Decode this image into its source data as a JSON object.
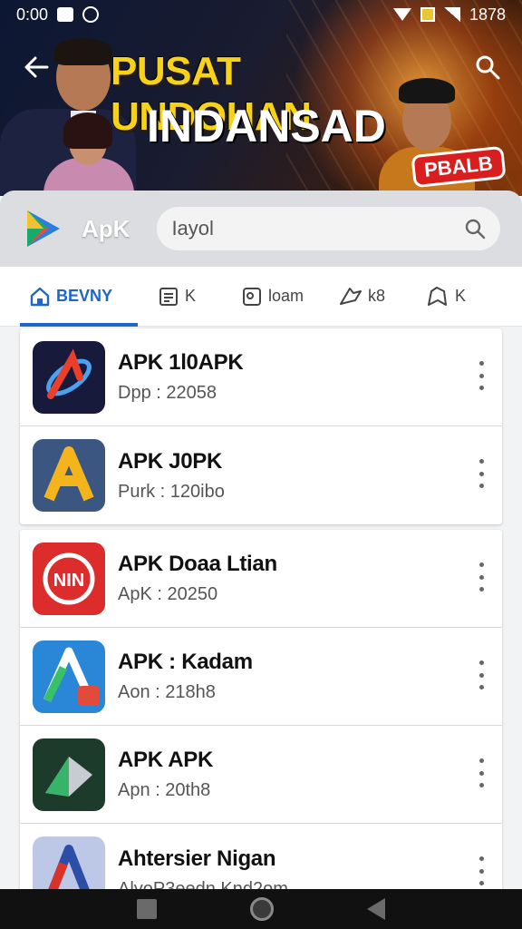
{
  "status_bar": {
    "time": "0:00",
    "battery": "1878"
  },
  "banner": {
    "title": "PUSAT UNDOHAN",
    "subtitle": "INDANSAD",
    "badge": "PBALB"
  },
  "header": {
    "app_name": "ApK",
    "search": {
      "value": "Iayol",
      "placeholder": ""
    }
  },
  "tabs": [
    {
      "label": "BEVNY",
      "icon": "home-icon",
      "active": true
    },
    {
      "label": "K",
      "icon": "document-icon",
      "active": false
    },
    {
      "label": "loam",
      "icon": "image-icon",
      "active": false
    },
    {
      "label": "k8",
      "icon": "tag-icon",
      "active": false
    },
    {
      "label": "K",
      "icon": "bookmark-icon",
      "active": false
    }
  ],
  "apps": [
    {
      "title": "APK 1l0APK",
      "subtitle": "Dpp : 22058",
      "icon_color": "#171a3a"
    },
    {
      "title": "APK J0PK",
      "subtitle": "Purk : 120ibo",
      "icon_color": "#3b5680"
    },
    {
      "title": "APK Doaa Ltian",
      "subtitle": "ApK : 20250",
      "icon_color": "#dd2c2c"
    },
    {
      "title": "APK : Kadam",
      "subtitle": "Aon : 218h8",
      "icon_color": "#2a86d6"
    },
    {
      "title": "APK APK",
      "subtitle": "Apn : 20th8",
      "icon_color": "#1d3b2b"
    },
    {
      "title": "Ahtersier Nigan",
      "subtitle": "AlyoP3eedn Knd2om",
      "icon_color": "#bcc8e6"
    }
  ],
  "colors": {
    "accent": "#1e66c8",
    "banner_title": "#f6d21a",
    "badge": "#d81e1e"
  }
}
